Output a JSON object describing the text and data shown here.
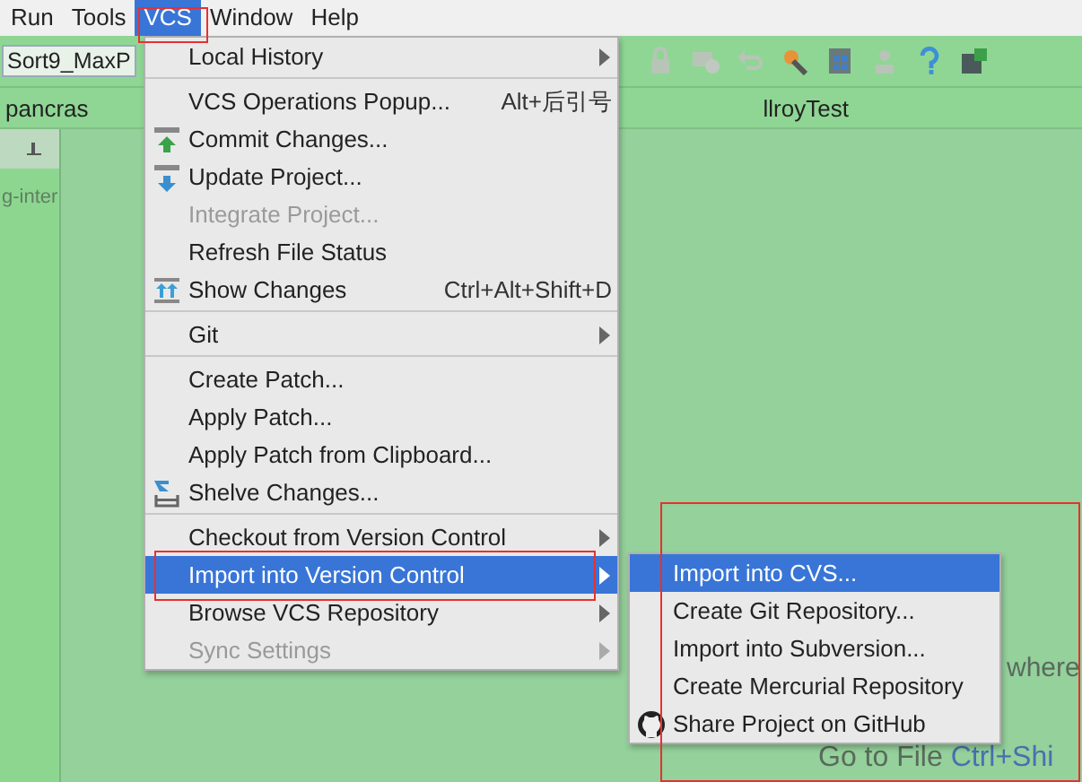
{
  "menubar": [
    {
      "label": "Run",
      "selected": false
    },
    {
      "label": "Tools",
      "selected": false
    },
    {
      "label": "VCS",
      "selected": true
    },
    {
      "label": "Window",
      "selected": false
    },
    {
      "label": "Help",
      "selected": false
    }
  ],
  "toolbar": {
    "run_config": "Sort9_MaxP"
  },
  "breadcrumbs": [
    "pancras",
    "llroyTest"
  ],
  "project_panel": {
    "item": "g-inter"
  },
  "editor_hints": [
    {
      "text": "where"
    },
    {
      "text": "Go to File",
      "shortcut": "Ctrl+Shi"
    }
  ],
  "vcs_menu": [
    {
      "kind": "plain",
      "label": "Local History",
      "submenu": true,
      "disabled": false,
      "selected": false
    },
    {
      "kind": "separator"
    },
    {
      "kind": "plain",
      "label": "VCS Operations Popup...",
      "shortcut": "Alt+后引号",
      "disabled": false,
      "selected": false
    },
    {
      "kind": "commit",
      "label": "Commit Changes...",
      "disabled": false,
      "selected": false
    },
    {
      "kind": "update",
      "label": "Update Project...",
      "disabled": false,
      "selected": false
    },
    {
      "kind": "plain",
      "label": "Integrate Project...",
      "disabled": true,
      "selected": false
    },
    {
      "kind": "plain",
      "label": "Refresh File Status",
      "disabled": false,
      "selected": false
    },
    {
      "kind": "changes",
      "label": "Show Changes",
      "shortcut": "Ctrl+Alt+Shift+D",
      "disabled": false,
      "selected": false
    },
    {
      "kind": "separator"
    },
    {
      "kind": "plain",
      "label": "Git",
      "submenu": true,
      "disabled": false,
      "selected": false
    },
    {
      "kind": "separator"
    },
    {
      "kind": "plain",
      "label": "Create Patch...",
      "disabled": false,
      "selected": false
    },
    {
      "kind": "plain",
      "label": "Apply Patch...",
      "disabled": false,
      "selected": false
    },
    {
      "kind": "plain",
      "label": "Apply Patch from Clipboard...",
      "disabled": false,
      "selected": false
    },
    {
      "kind": "shelve",
      "label": "Shelve Changes...",
      "disabled": false,
      "selected": false
    },
    {
      "kind": "separator"
    },
    {
      "kind": "plain",
      "label": "Checkout from Version Control",
      "submenu": true,
      "disabled": false,
      "selected": false
    },
    {
      "kind": "plain",
      "label": "Import into Version Control",
      "submenu": true,
      "disabled": false,
      "selected": true
    },
    {
      "kind": "plain",
      "label": "Browse VCS Repository",
      "submenu": true,
      "disabled": false,
      "selected": false
    },
    {
      "kind": "plain",
      "label": "Sync Settings",
      "submenu": true,
      "disabled": true,
      "selected": false
    }
  ],
  "import_submenu": [
    {
      "kind": "plain",
      "label": "Import into CVS...",
      "selected": true
    },
    {
      "kind": "plain",
      "label": "Create Git Repository...",
      "selected": false
    },
    {
      "kind": "plain",
      "label": "Import into Subversion...",
      "selected": false
    },
    {
      "kind": "plain",
      "label": "Create Mercurial Repository",
      "selected": false
    },
    {
      "kind": "github",
      "label": "Share Project on GitHub",
      "selected": false
    }
  ]
}
